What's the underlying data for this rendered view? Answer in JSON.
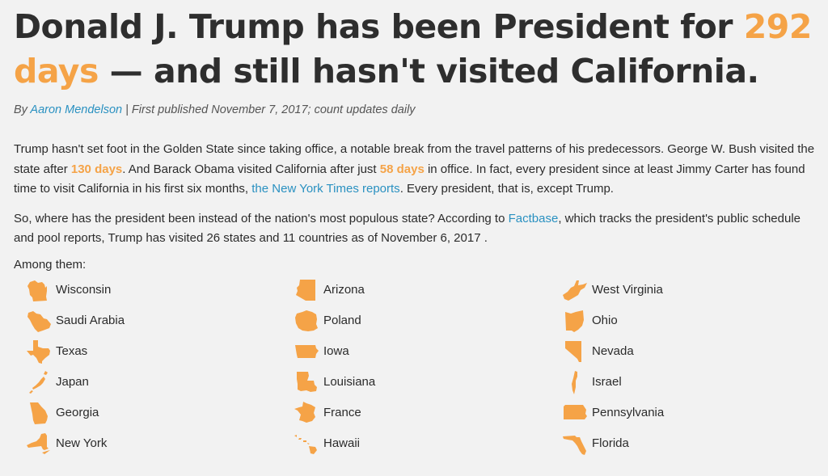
{
  "headline": {
    "part1": "Donald J. Trump has been President for ",
    "days_count": "292",
    "days_word": "days",
    "part2": " — and still hasn't visited California."
  },
  "byline": {
    "by": "By ",
    "author": "Aaron Mendelson",
    "rest": " | First published November 7, 2017; count updates daily"
  },
  "para1": {
    "t1": "Trump hasn't set foot in the Golden State since taking office, a notable break from the travel patterns of his predecessors. George W. Bush visited the state after ",
    "bush_days": "130 days",
    "t2": ". And Barack Obama visited California after just ",
    "obama_days": "58 days",
    "t3": " in office. In fact, every president since at least Jimmy Carter has found time to visit California in his first six months, ",
    "nyt_link": "the New York Times reports",
    "t4": ". Every president, that is, except Trump."
  },
  "para2": {
    "t1": "So, where has the president been instead of the nation's most populous state? According to ",
    "factbase_link": "Factbase",
    "t2": ", which tracks the president's public schedule and pool reports, Trump has visited 26 states and 11 countries as of November 6, 2017 ."
  },
  "among_label": "Among them:",
  "places": [
    [
      "Wisconsin",
      "Arizona",
      "West Virginia"
    ],
    [
      "Saudi Arabia",
      "Poland",
      "Ohio"
    ],
    [
      "Texas",
      "Iowa",
      "Nevada"
    ],
    [
      "Japan",
      "Louisiana",
      "Israel"
    ],
    [
      "Georgia",
      "France",
      "Pennsylvania"
    ],
    [
      "New York",
      "Hawaii",
      "Florida"
    ]
  ],
  "colors": {
    "accent": "#f5a347",
    "link": "#2a91c1",
    "text": "#2b2b2b"
  }
}
